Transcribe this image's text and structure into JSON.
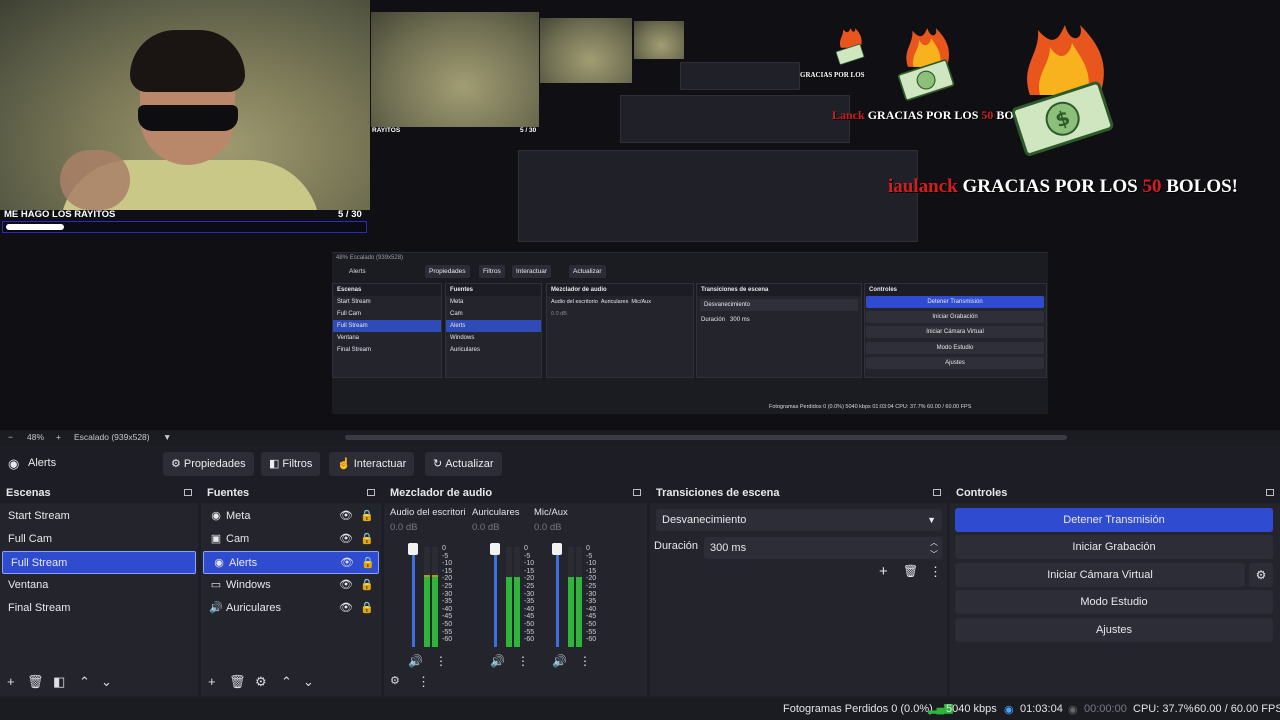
{
  "preview": {
    "cam_caption": "ME HAGO LOS RAYITOS",
    "cam_count": "5  / 30",
    "goal_fraction": 0.16,
    "mini_caption": "RAYITOS",
    "mini_count": "5  / 30",
    "alert_name": "iaulanck",
    "alert_prefix": "GRACIAS POR LOS ",
    "alert_amount": "50",
    "alert_suffix": " BOLOS!",
    "alert_short": "GRACIAS POR LOS",
    "alert_short_suffix": " BOLO",
    "alert_tiny_name": "Lanck",
    "alert_tiny": "GRACIAS POR LOS",
    "nested": {
      "zoom": "48%",
      "scale": "Escalado (939x528)",
      "source": "Alerts",
      "buttons": [
        "Propiedades",
        "Filtros",
        "Interactuar",
        "Actualizar"
      ],
      "scenes_title": "Escenas",
      "scenes": [
        "Start Stream",
        "Full Cam",
        "Full Stream",
        "Ventana",
        "Final Stream"
      ],
      "sources_title": "Fuentes",
      "sources": [
        "Meta",
        "Cam",
        "Alerts",
        "Windows",
        "Auriculares"
      ],
      "mixer_title": "Mezclador de audio",
      "mixer_channels": [
        "Audio del escritorio",
        "Auriculares",
        "Mic/Aux"
      ],
      "mixer_db": "0.0 dB",
      "transitions_title": "Transiciones de escena",
      "transition": "Desvanecimiento",
      "duration_label": "Duración",
      "duration": "300 ms",
      "controls_title": "Controles",
      "controls": [
        "Detener Transmisión",
        "Iniciar Grabación",
        "Iniciar Cámara Virtual",
        "Modo Estudio",
        "Ajustes"
      ],
      "status": "Fotogramas Perdidos 0 (0.0%)   5040 kbps   01:03:04   CPU: 37.7%   60.00 / 60.00 FPS"
    }
  },
  "zoombar": {
    "minus": "−",
    "zoom": "48%",
    "plus": "+",
    "scale": "Escalado (939x528)"
  },
  "toolbar": {
    "source_name": "Alerts",
    "properties": "Propiedades",
    "filters": "Filtros",
    "interact": "Interactuar",
    "refresh": "Actualizar"
  },
  "scenes": {
    "title": "Escenas",
    "items": [
      "Start Stream",
      "Full Cam",
      "Full Stream",
      "Ventana",
      "Final Stream"
    ],
    "selected_index": 2
  },
  "sources": {
    "title": "Fuentes",
    "items": [
      {
        "label": "Meta",
        "icon": "globe-icon"
      },
      {
        "label": "Cam",
        "icon": "camera-icon"
      },
      {
        "label": "Alerts",
        "icon": "globe-icon"
      },
      {
        "label": "Windows",
        "icon": "window-icon"
      },
      {
        "label": "Auriculares",
        "icon": "speaker-icon"
      }
    ],
    "selected_index": 2
  },
  "mixer": {
    "title": "Mezclador de audio",
    "channels": [
      {
        "name": "Audio del escritoric",
        "db": "0.0 dB",
        "level": 0.72
      },
      {
        "name": "Auriculares",
        "db": "0.0 dB",
        "level": 0.7
      },
      {
        "name": "Mic/Aux",
        "db": "0.0 dB",
        "level": 0.7
      }
    ],
    "scale": [
      "0",
      "-5",
      "-10",
      "-15",
      "-20",
      "-25",
      "-30",
      "-35",
      "-40",
      "-45",
      "-50",
      "-55",
      "-60"
    ]
  },
  "transitions": {
    "title": "Transiciones de escena",
    "selected": "Desvanecimiento",
    "duration_label": "Duración",
    "duration": "300 ms"
  },
  "controls": {
    "title": "Controles",
    "stop_stream": "Detener Transmisión",
    "start_recording": "Iniciar Grabación",
    "start_virtual_cam": "Iniciar Cámara Virtual",
    "studio_mode": "Modo Estudio",
    "settings": "Ajustes"
  },
  "status": {
    "dropped_frames": "Fotogramas Perdidos 0 (0.0%)",
    "bitrate": "5040 kbps",
    "stream_time": "01:03:04",
    "record_time": "00:00:00",
    "cpu": "CPU: 37.7%",
    "fps": "60.00 / 60.00 FPS"
  },
  "colors": {
    "accent": "#2f4bd0",
    "panel": "#23242c",
    "background": "#1d1f26",
    "meter_green": "#2fb53a",
    "alert_red": "#d21e1e"
  }
}
